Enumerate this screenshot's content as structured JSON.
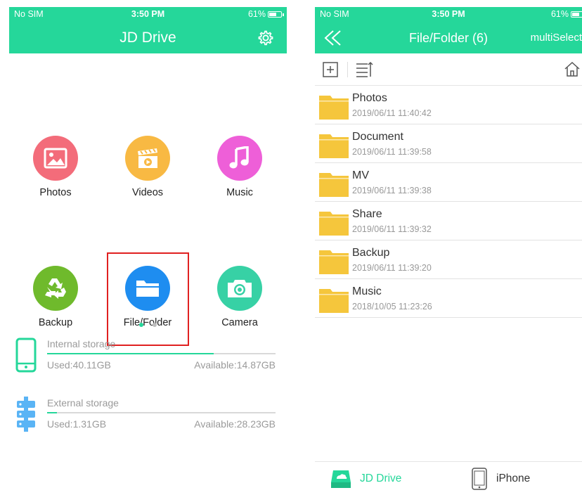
{
  "colors": {
    "accent": "#25d79a",
    "selection": "#e02020",
    "folder": "#f5c63c"
  },
  "left": {
    "status": {
      "carrier": "No SIM",
      "time": "3:50 PM",
      "battery": "61%"
    },
    "title": "JD Drive",
    "settings_icon": "gear-icon",
    "tiles": [
      {
        "label": "Photos",
        "icon": "photo-icon",
        "color": "#f36c7a"
      },
      {
        "label": "Videos",
        "icon": "video-icon",
        "color": "#f8b943"
      },
      {
        "label": "Music",
        "icon": "music-icon",
        "color": "#ee5fd8"
      },
      {
        "label": "Backup",
        "icon": "recycle-icon",
        "color": "#6fba2c"
      },
      {
        "label": "File/Folder",
        "icon": "folder-icon",
        "color": "#1e8df0",
        "selected": true
      },
      {
        "label": "Camera",
        "icon": "camera-icon",
        "color": "#37d1a5"
      }
    ],
    "page_indicator": {
      "pages": 2,
      "current": 1
    },
    "storage": [
      {
        "title": "Internal storage",
        "used": "Used:40.11GB",
        "available": "Available:14.87GB",
        "fraction_used": 0.73,
        "icon": "phone-storage-icon"
      },
      {
        "title": "External storage",
        "used": "Used:1.31GB",
        "available": "Available:28.23GB",
        "fraction_used": 0.044,
        "icon": "external-drive-icon"
      }
    ]
  },
  "right": {
    "status": {
      "carrier": "No SIM",
      "time": "3:50 PM",
      "battery": "61%"
    },
    "title": "File/Folder (6)",
    "multi_select": "multiSelect",
    "toolbar": {
      "new_folder_icon": "new-folder-icon",
      "sort_icon": "sort-icon",
      "home_icon": "home-icon"
    },
    "files": [
      {
        "name": "Photos",
        "date": "2019/06/11 11:40:42"
      },
      {
        "name": "Document",
        "date": "2019/06/11 11:39:58"
      },
      {
        "name": "MV",
        "date": "2019/06/11 11:39:38"
      },
      {
        "name": "Share",
        "date": "2019/06/11 11:39:32"
      },
      {
        "name": "Backup",
        "date": "2019/06/11 11:39:20"
      },
      {
        "name": "Music",
        "date": "2018/10/05 11:23:26"
      }
    ],
    "tabs": [
      {
        "label": "JD Drive",
        "icon": "drive-icon",
        "active": true
      },
      {
        "label": "iPhone",
        "icon": "iphone-icon",
        "active": false
      }
    ]
  }
}
